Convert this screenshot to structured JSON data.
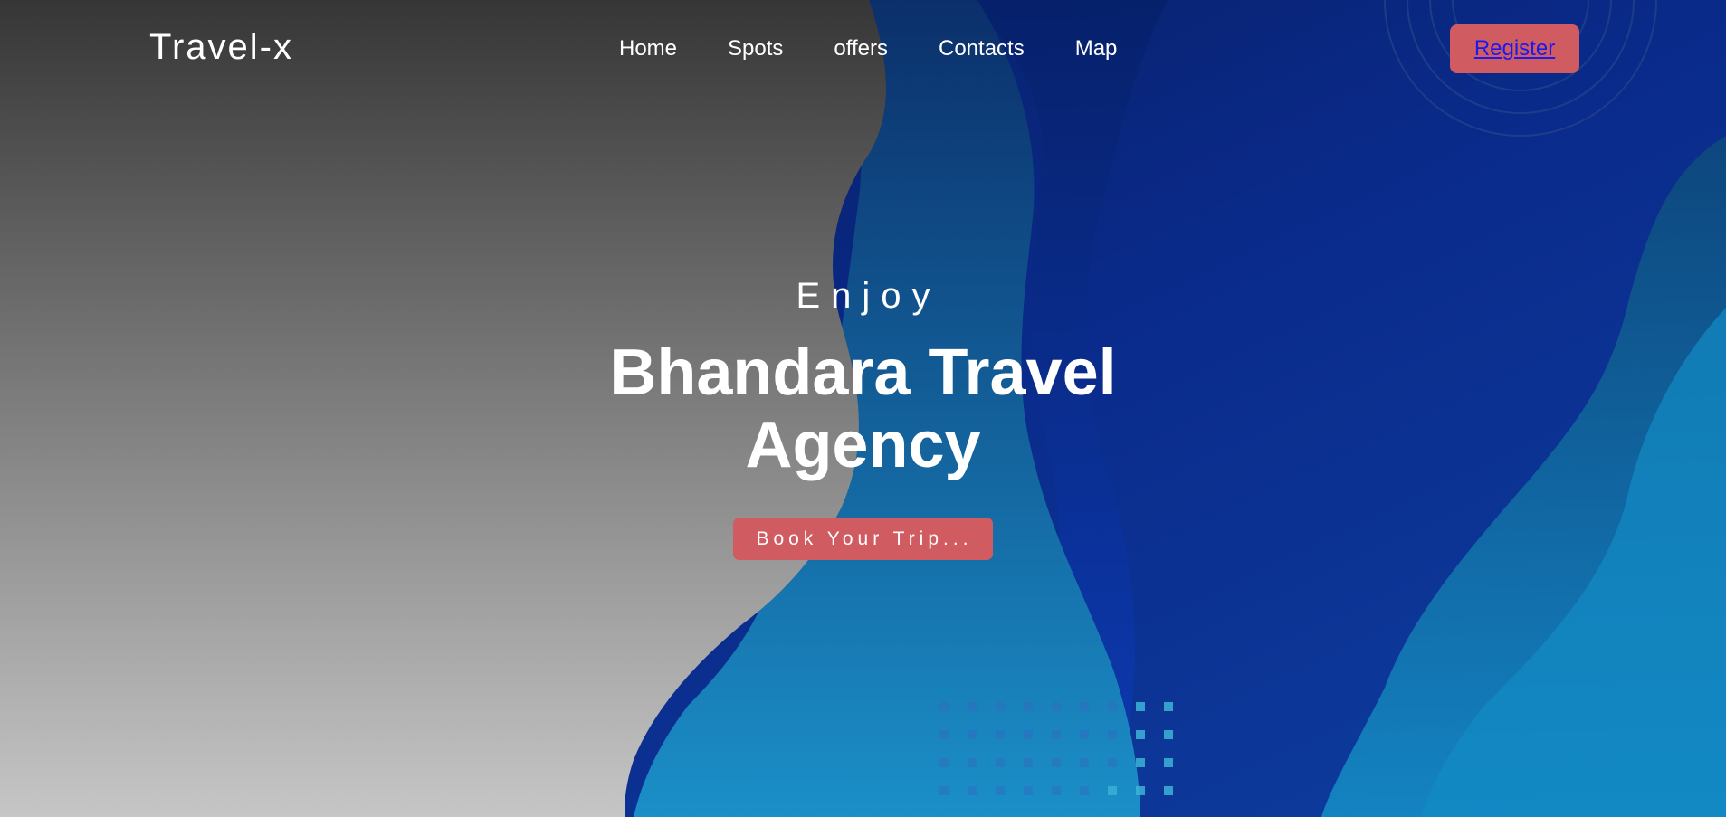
{
  "brand": {
    "logo_text": "Travel-x"
  },
  "nav": {
    "items": [
      {
        "label": "Home"
      },
      {
        "label": "Spots"
      },
      {
        "label": "offers"
      },
      {
        "label": "Contacts"
      },
      {
        "label": "Map"
      }
    ],
    "register_label": "Register"
  },
  "hero": {
    "subtitle": "Enjoy",
    "headline_line1": "Bhandara Travel",
    "headline_line2": "Agency",
    "cta_label": "Book Your Trip..."
  },
  "colors": {
    "accent": "#d05c62",
    "link": "#1a1aee",
    "gradient_top": "#3a3a3a",
    "gradient_bottom": "#c4c4c4",
    "blue_deep": "#061a5e",
    "blue_light": "#1592c8"
  }
}
